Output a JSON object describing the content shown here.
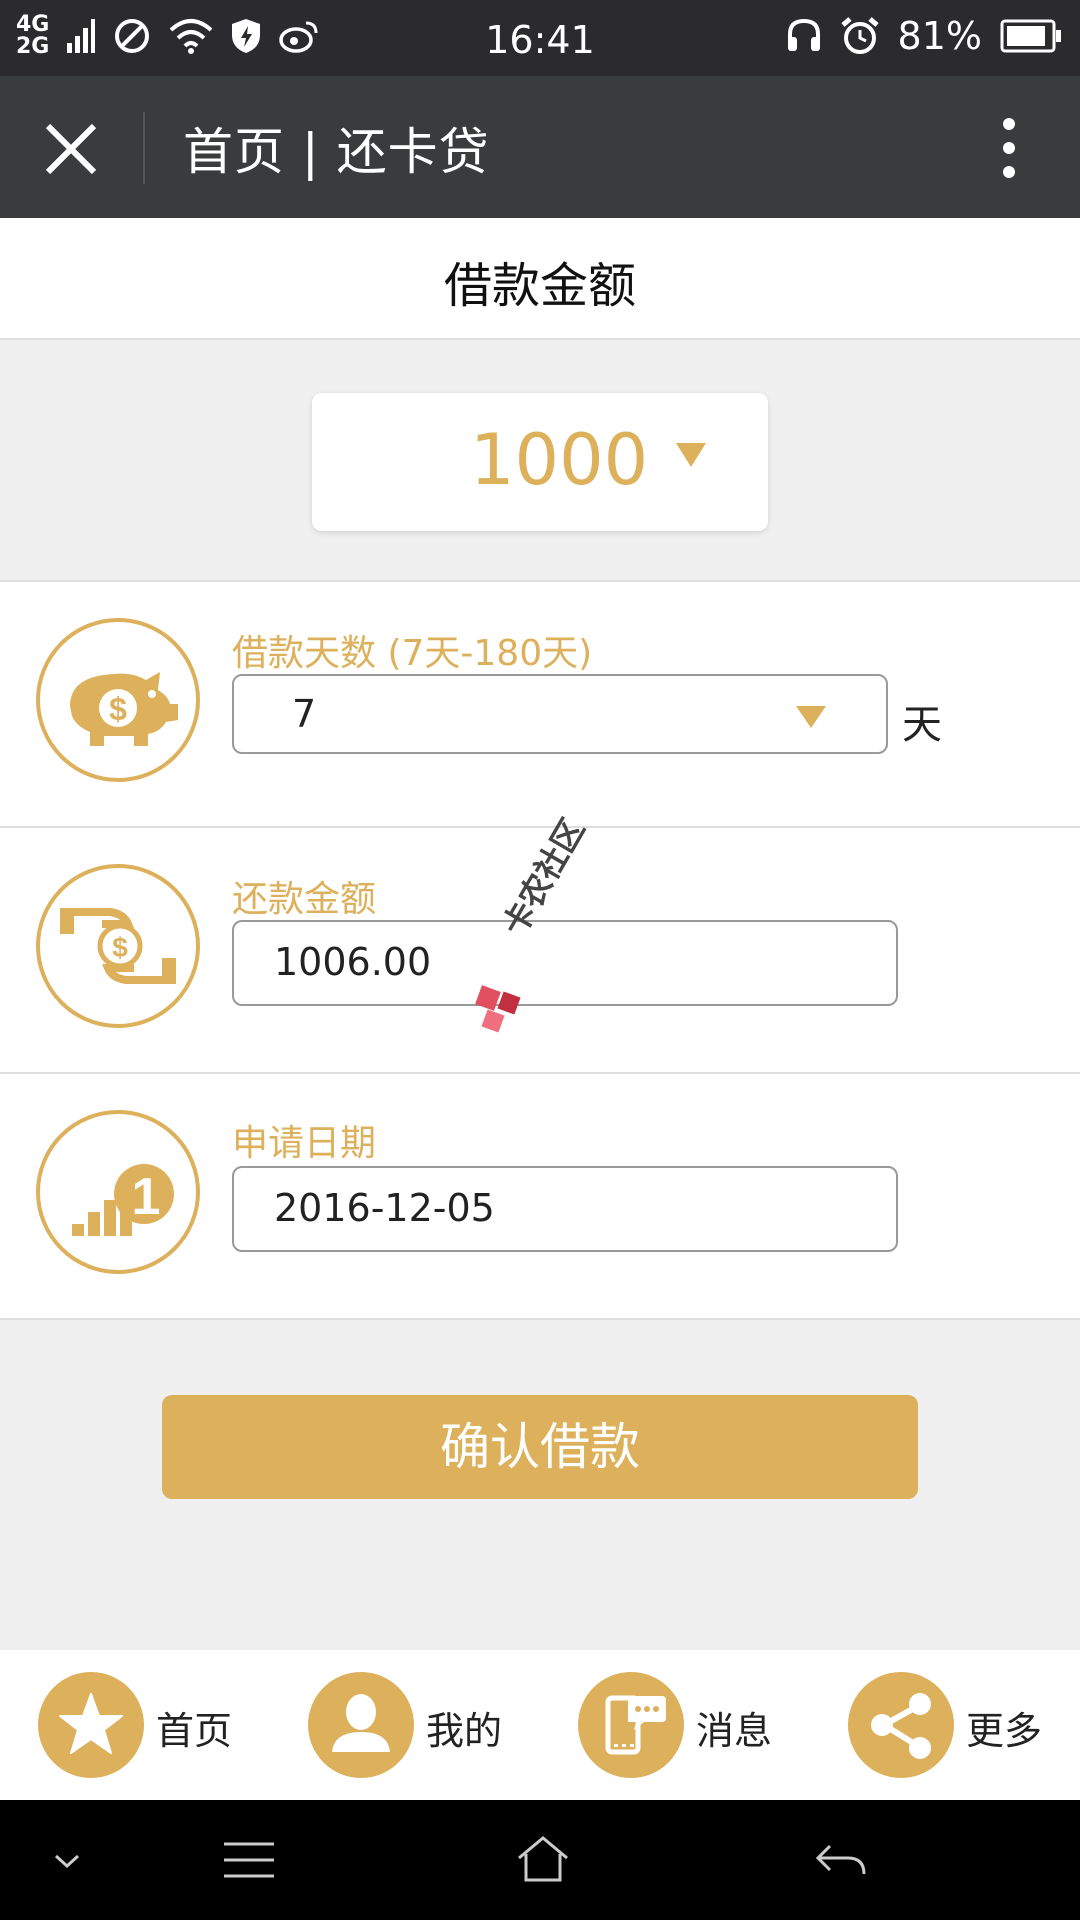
{
  "status_bar": {
    "network_top": "4G",
    "network_bottom": "2G",
    "time": "16:41",
    "battery": "81%"
  },
  "nav": {
    "title": "首页 | 还卡贷"
  },
  "header": {
    "title": "借款金额"
  },
  "amount": {
    "value": "1000"
  },
  "rows": {
    "days": {
      "label": "借款天数 (7天-180天)",
      "value": "7",
      "unit": "天"
    },
    "repay": {
      "label": "还款金额",
      "value": "1006.00"
    },
    "date": {
      "label": "申请日期",
      "value": "2016-12-05"
    }
  },
  "confirm_button": {
    "label": "确认借款"
  },
  "tabbar": {
    "items": [
      {
        "label": "首页",
        "icon": "star-icon"
      },
      {
        "label": "我的",
        "icon": "user-icon"
      },
      {
        "label": "消息",
        "icon": "message-icon"
      },
      {
        "label": "更多",
        "icon": "share-icon"
      }
    ]
  },
  "watermark": {
    "text": "卡农社区"
  },
  "colors": {
    "accent": "#ddb05c",
    "nav_bg": "#3a3b3d",
    "status_bg": "#2b2b2d"
  }
}
